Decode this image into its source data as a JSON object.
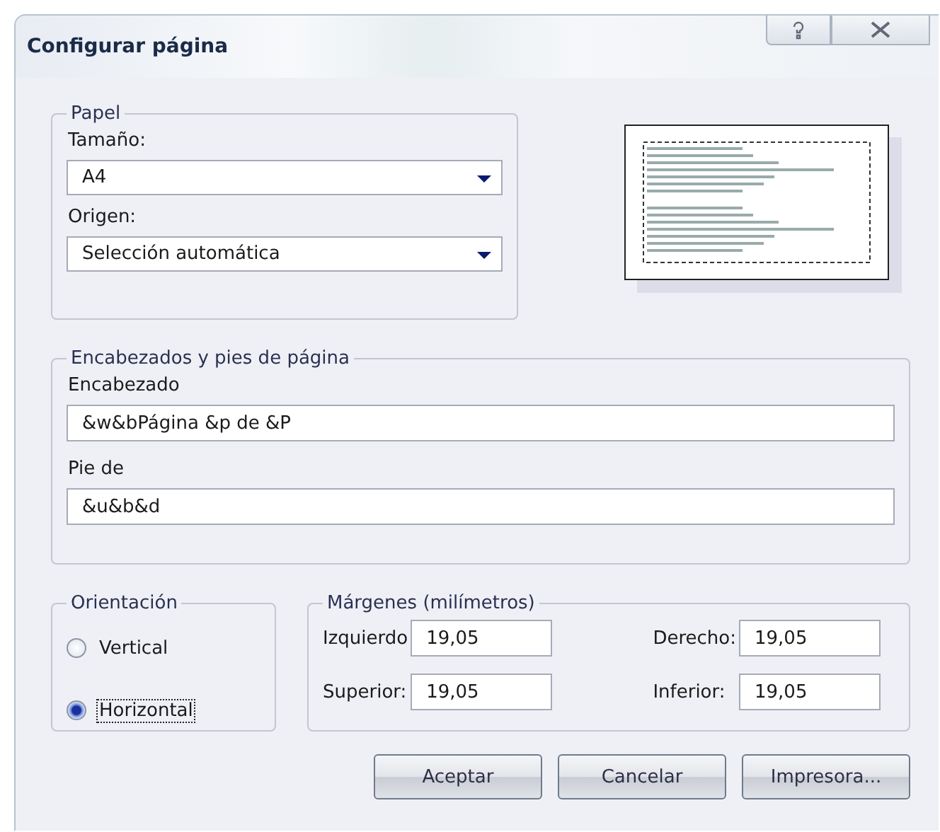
{
  "window": {
    "title": "Configurar página"
  },
  "paper": {
    "legend": "Papel",
    "size": {
      "label": "Tamaño:",
      "value": "A4"
    },
    "source": {
      "label": "Origen:",
      "value": "Selección automática"
    }
  },
  "headers_footers": {
    "legend": "Encabezados y pies de página",
    "header": {
      "label": "Encabezado",
      "value": "&w&bPágina &p de &P"
    },
    "footer": {
      "label": "Pie de",
      "value": "&u&b&d"
    }
  },
  "orientation": {
    "legend": "Orientación",
    "options": [
      {
        "label": "Vertical",
        "selected": false
      },
      {
        "label": "Horizontal",
        "selected": true
      }
    ]
  },
  "margins": {
    "legend": "Márgenes (milímetros)",
    "fields": [
      {
        "label": "Izquierdo",
        "value": "19,05"
      },
      {
        "label": "Derecho:",
        "value": "19,05"
      },
      {
        "label": "Superior:",
        "value": "19,05"
      },
      {
        "label": "Inferior:",
        "value": "19,05"
      }
    ]
  },
  "buttons": [
    {
      "label": "Aceptar"
    },
    {
      "label": "Cancelar"
    },
    {
      "label": "Impresora..."
    }
  ]
}
